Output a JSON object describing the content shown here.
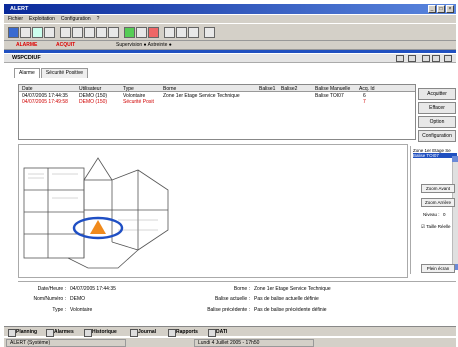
{
  "window": {
    "title": "ALERT",
    "controls": [
      "_",
      "□",
      "×"
    ]
  },
  "menu": [
    "Fichier",
    "Exploitation",
    "Configuration",
    "?"
  ],
  "toolbar2": {
    "alarm": "ALARME",
    "acquit": "ACQUIT",
    "supervision": "Supervision ● Astreinte ●"
  },
  "site": {
    "name": "W5PCDIUF"
  },
  "tabs": [
    "Alarme",
    "Sécurité Positive"
  ],
  "alarm_table": {
    "columns": [
      "Date",
      "Utilisateur",
      "Type",
      "Borne",
      "Balise1",
      "Balise2",
      "Balise Manuelle",
      "Acq. Id"
    ],
    "rows": [
      {
        "date": "04/07/2005 17:44:35",
        "user": "DEMO (150)",
        "type": "Volontaire",
        "borne": "Zone 1er Etage Service Technique",
        "balise1": "",
        "balise2": "",
        "manuelle": "Balise TOI07",
        "acq": "6",
        "color": "#000000"
      },
      {
        "date": "04/07/2005 17:49:58",
        "user": "DEMO (150)",
        "type": "Sécurité Posit",
        "borne": "",
        "balise1": "",
        "balise2": "",
        "manuelle": "",
        "acq": "7",
        "color": "#d00000"
      }
    ]
  },
  "side_buttons": [
    "Acquitter",
    "Effacer",
    "Option",
    "Configuration"
  ],
  "right_list": {
    "items": [
      "Zone 1er Etage Se",
      "Balise TOI07"
    ]
  },
  "plan_controls": {
    "zoom_in": "Zoom Avant",
    "zoom_out": "Zoom Arrière",
    "level_label": "Niveau :",
    "level_value": "0",
    "tracking": "Taille Réelle",
    "fullscreen": "Plein écran"
  },
  "details": {
    "date_label": "Date/Heure :",
    "date_value": "04/07/2005 17:44:35",
    "name_label": "Nom/Numéro :",
    "name_value": "DEMO",
    "type_label": "Type :",
    "type_value": "Volontaire",
    "borne_label": "Borne :",
    "borne_value": "Zone 1er Etage Service Technique",
    "balise_label": "Balise actuelle :",
    "balise_value": "Pas de balise actuelle définie",
    "prev_label": "Balise précédente :",
    "prev_value": "Pas de balise précédente définie"
  },
  "bottom_tabs": [
    "Planning",
    "Alarmes",
    "Historique",
    "Journal",
    "Rapports",
    "DATI"
  ],
  "status": {
    "left": "ALERT (Système)",
    "right": "Lundi 4 Juillet 2005 - 17h50"
  },
  "colors": {
    "title_bar": "#0a2a9a",
    "alarm_red": "#d00000",
    "marker_blue": "#1f4fc4",
    "marker_orange": "#f08a1c"
  }
}
